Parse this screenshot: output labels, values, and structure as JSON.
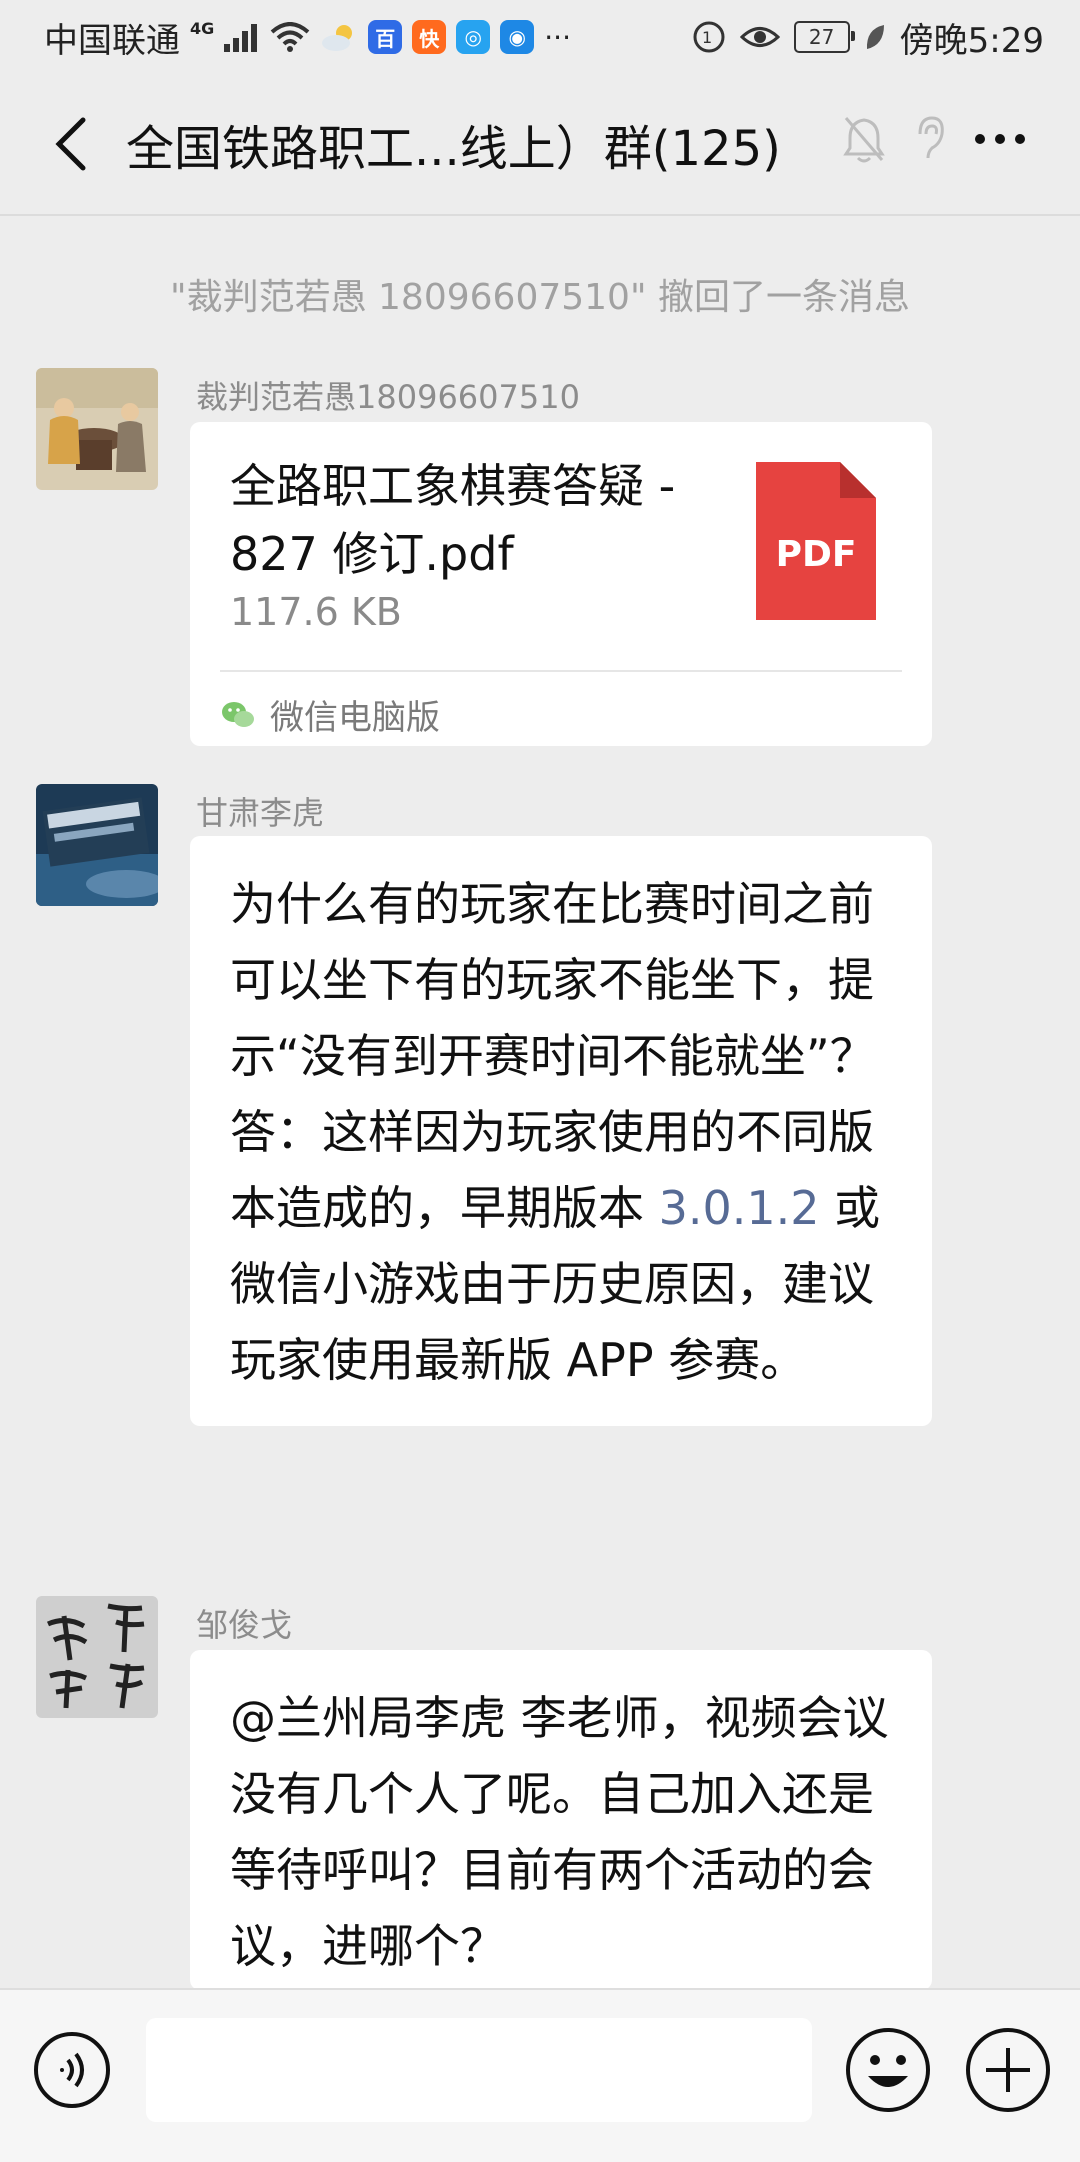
{
  "status_bar": {
    "carrier": "中国联通",
    "network": "4G",
    "battery": "27",
    "time": "傍晚5:29"
  },
  "header": {
    "title": "全国铁路职工...线上）群(125)"
  },
  "chat": {
    "system_message": "\"裁判范若愚 18096607510\" 撤回了一条消息",
    "messages": [
      {
        "sender": "裁判范若愚18096607510",
        "file": {
          "name": "全路职工象棋赛答疑 - 827 修订.pdf",
          "size": "117.6 KB",
          "type_label": "PDF",
          "source": "微信电脑版"
        }
      },
      {
        "sender": "甘肃李虎",
        "text_before_link": "为什么有的玩家在比赛时间之前可以坐下有的玩家不能坐下，提示“没有到开赛时间不能就坐”？答：这样因为玩家使用的不同版本造成的，早期版本 ",
        "link": "3.0.1.2",
        "text_after_link": " 或微信小游戏由于历史原因，建议玩家使用最新版 APP 参赛。"
      },
      {
        "sender": "邹俊戈",
        "text": "@兰州局李虎  李老师，视频会议没有几个人了呢。自己加入还是等待呼叫？目前有两个活动的会议，进哪个？"
      }
    ]
  },
  "input_bar": {
    "placeholder": ""
  },
  "colors": {
    "background": "#ededed",
    "bubble": "#ffffff",
    "link": "#576b95",
    "pdf_red": "#e64340"
  }
}
